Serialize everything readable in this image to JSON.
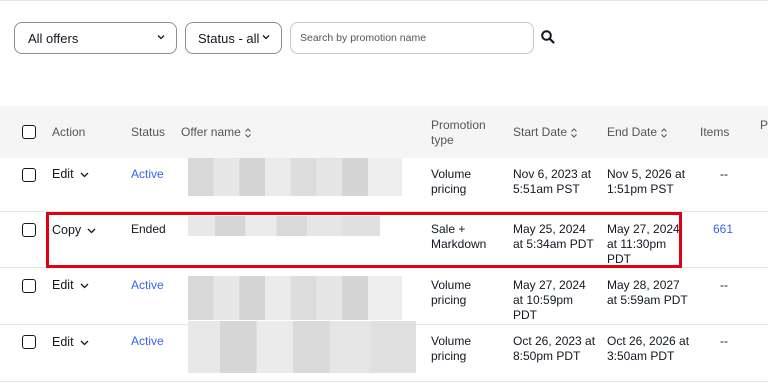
{
  "filters": {
    "offers_select": "All offers",
    "status_select": "Status - all",
    "search_placeholder": "Search by promotion name"
  },
  "table": {
    "headers": {
      "action": "Action",
      "status": "Status",
      "offer_name": "Offer name",
      "promotion_type": "Promotion type",
      "start_date": "Start Date",
      "end_date": "End Date",
      "items": "Items",
      "extra": "P"
    },
    "rows": [
      {
        "action": "Edit",
        "status": "Active",
        "promotion_type": "Volume pricing",
        "start_date": "Nov 6, 2023 at 5:51am PST",
        "end_date": "Nov 5, 2026 at 1:51pm PST",
        "items": "--"
      },
      {
        "action": "Copy",
        "status": "Ended",
        "promotion_type": "Sale + Markdown",
        "start_date": "May 25, 2024 at 5:34am PDT",
        "end_date": "May 27, 2024 at 11:30pm PDT",
        "items": "661"
      },
      {
        "action": "Edit",
        "status": "Active",
        "promotion_type": "Volume pricing",
        "start_date": "May 27, 2024 at 10:59pm PDT",
        "end_date": "May 28, 2027 at 5:59am PDT",
        "items": "--"
      },
      {
        "action": "Edit",
        "status": "Active",
        "promotion_type": "Volume pricing",
        "start_date": "Oct 26, 2023 at 8:50pm PDT",
        "end_date": "Oct 26, 2026 at 3:50am PDT",
        "items": "--"
      }
    ]
  },
  "colors": {
    "link": "#3665f3",
    "highlight": "#e00010"
  }
}
